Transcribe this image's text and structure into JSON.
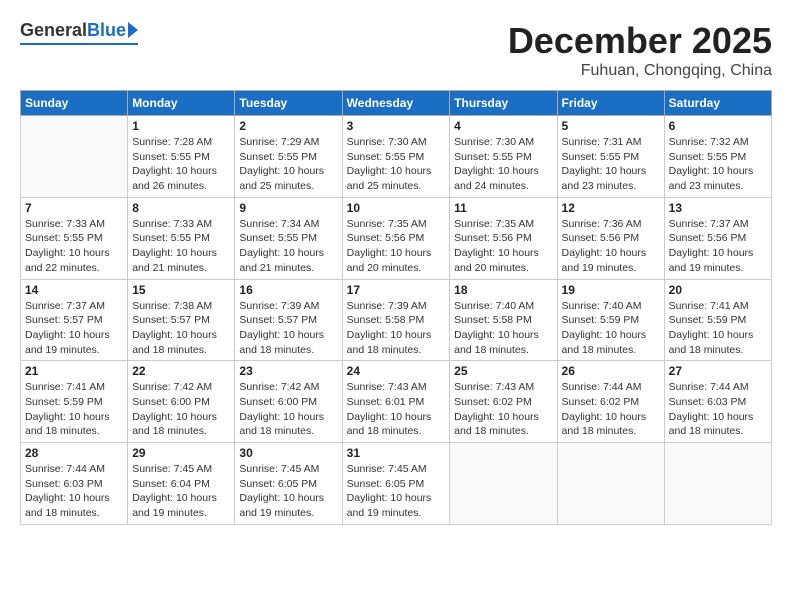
{
  "logo": {
    "general": "General",
    "blue": "Blue"
  },
  "title": {
    "month": "December 2025",
    "location": "Fuhuan, Chongqing, China"
  },
  "weekdays": [
    "Sunday",
    "Monday",
    "Tuesday",
    "Wednesday",
    "Thursday",
    "Friday",
    "Saturday"
  ],
  "weeks": [
    [
      {
        "day": "",
        "info": ""
      },
      {
        "day": "1",
        "info": "Sunrise: 7:28 AM\nSunset: 5:55 PM\nDaylight: 10 hours\nand 26 minutes."
      },
      {
        "day": "2",
        "info": "Sunrise: 7:29 AM\nSunset: 5:55 PM\nDaylight: 10 hours\nand 25 minutes."
      },
      {
        "day": "3",
        "info": "Sunrise: 7:30 AM\nSunset: 5:55 PM\nDaylight: 10 hours\nand 25 minutes."
      },
      {
        "day": "4",
        "info": "Sunrise: 7:30 AM\nSunset: 5:55 PM\nDaylight: 10 hours\nand 24 minutes."
      },
      {
        "day": "5",
        "info": "Sunrise: 7:31 AM\nSunset: 5:55 PM\nDaylight: 10 hours\nand 23 minutes."
      },
      {
        "day": "6",
        "info": "Sunrise: 7:32 AM\nSunset: 5:55 PM\nDaylight: 10 hours\nand 23 minutes."
      }
    ],
    [
      {
        "day": "7",
        "info": "Sunrise: 7:33 AM\nSunset: 5:55 PM\nDaylight: 10 hours\nand 22 minutes."
      },
      {
        "day": "8",
        "info": "Sunrise: 7:33 AM\nSunset: 5:55 PM\nDaylight: 10 hours\nand 21 minutes."
      },
      {
        "day": "9",
        "info": "Sunrise: 7:34 AM\nSunset: 5:55 PM\nDaylight: 10 hours\nand 21 minutes."
      },
      {
        "day": "10",
        "info": "Sunrise: 7:35 AM\nSunset: 5:56 PM\nDaylight: 10 hours\nand 20 minutes."
      },
      {
        "day": "11",
        "info": "Sunrise: 7:35 AM\nSunset: 5:56 PM\nDaylight: 10 hours\nand 20 minutes."
      },
      {
        "day": "12",
        "info": "Sunrise: 7:36 AM\nSunset: 5:56 PM\nDaylight: 10 hours\nand 19 minutes."
      },
      {
        "day": "13",
        "info": "Sunrise: 7:37 AM\nSunset: 5:56 PM\nDaylight: 10 hours\nand 19 minutes."
      }
    ],
    [
      {
        "day": "14",
        "info": "Sunrise: 7:37 AM\nSunset: 5:57 PM\nDaylight: 10 hours\nand 19 minutes."
      },
      {
        "day": "15",
        "info": "Sunrise: 7:38 AM\nSunset: 5:57 PM\nDaylight: 10 hours\nand 18 minutes."
      },
      {
        "day": "16",
        "info": "Sunrise: 7:39 AM\nSunset: 5:57 PM\nDaylight: 10 hours\nand 18 minutes."
      },
      {
        "day": "17",
        "info": "Sunrise: 7:39 AM\nSunset: 5:58 PM\nDaylight: 10 hours\nand 18 minutes."
      },
      {
        "day": "18",
        "info": "Sunrise: 7:40 AM\nSunset: 5:58 PM\nDaylight: 10 hours\nand 18 minutes."
      },
      {
        "day": "19",
        "info": "Sunrise: 7:40 AM\nSunset: 5:59 PM\nDaylight: 10 hours\nand 18 minutes."
      },
      {
        "day": "20",
        "info": "Sunrise: 7:41 AM\nSunset: 5:59 PM\nDaylight: 10 hours\nand 18 minutes."
      }
    ],
    [
      {
        "day": "21",
        "info": "Sunrise: 7:41 AM\nSunset: 5:59 PM\nDaylight: 10 hours\nand 18 minutes."
      },
      {
        "day": "22",
        "info": "Sunrise: 7:42 AM\nSunset: 6:00 PM\nDaylight: 10 hours\nand 18 minutes."
      },
      {
        "day": "23",
        "info": "Sunrise: 7:42 AM\nSunset: 6:00 PM\nDaylight: 10 hours\nand 18 minutes."
      },
      {
        "day": "24",
        "info": "Sunrise: 7:43 AM\nSunset: 6:01 PM\nDaylight: 10 hours\nand 18 minutes."
      },
      {
        "day": "25",
        "info": "Sunrise: 7:43 AM\nSunset: 6:02 PM\nDaylight: 10 hours\nand 18 minutes."
      },
      {
        "day": "26",
        "info": "Sunrise: 7:44 AM\nSunset: 6:02 PM\nDaylight: 10 hours\nand 18 minutes."
      },
      {
        "day": "27",
        "info": "Sunrise: 7:44 AM\nSunset: 6:03 PM\nDaylight: 10 hours\nand 18 minutes."
      }
    ],
    [
      {
        "day": "28",
        "info": "Sunrise: 7:44 AM\nSunset: 6:03 PM\nDaylight: 10 hours\nand 18 minutes."
      },
      {
        "day": "29",
        "info": "Sunrise: 7:45 AM\nSunset: 6:04 PM\nDaylight: 10 hours\nand 19 minutes."
      },
      {
        "day": "30",
        "info": "Sunrise: 7:45 AM\nSunset: 6:05 PM\nDaylight: 10 hours\nand 19 minutes."
      },
      {
        "day": "31",
        "info": "Sunrise: 7:45 AM\nSunset: 6:05 PM\nDaylight: 10 hours\nand 19 minutes."
      },
      {
        "day": "",
        "info": ""
      },
      {
        "day": "",
        "info": ""
      },
      {
        "day": "",
        "info": ""
      }
    ]
  ]
}
